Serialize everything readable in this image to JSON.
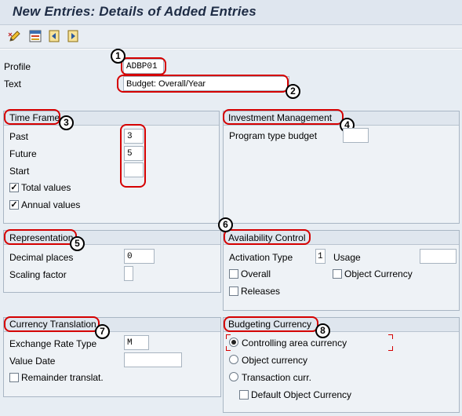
{
  "window": {
    "title": "New Entries: Details of Added Entries"
  },
  "toolbar": {
    "icons": [
      "edit-pencil-icon",
      "select-block-icon",
      "previous-entry-icon",
      "next-entry-icon"
    ]
  },
  "header": {
    "profile_label": "Profile",
    "profile_value": "ADBP01",
    "text_label": "Text",
    "text_value": "Budget: Overall/Year"
  },
  "time_frame": {
    "title": "Time Frame",
    "past_label": "Past",
    "past_value": "3",
    "future_label": "Future",
    "future_value": "5",
    "start_label": "Start",
    "start_value": "",
    "total_values_label": "Total values",
    "total_values_checked": true,
    "annual_values_label": "Annual values",
    "annual_values_checked": true
  },
  "investment_management": {
    "title": "Investment Management",
    "program_type_label": "Program type budget",
    "program_type_value": ""
  },
  "representation": {
    "title": "Representation",
    "decimal_places_label": "Decimal places",
    "decimal_places_value": "0",
    "scaling_factor_label": "Scaling factor",
    "scaling_factor_value": ""
  },
  "availability_control": {
    "title": "Availability Control",
    "activation_type_label": "Activation Type",
    "activation_type_value": "1",
    "usage_label": "Usage",
    "usage_value": "",
    "overall_label": "Overall",
    "object_currency_label": "Object Currency",
    "releases_label": "Releases"
  },
  "currency_translation": {
    "title": "Currency Translation",
    "exchange_rate_label": "Exchange Rate Type",
    "exchange_rate_value": "M",
    "value_date_label": "Value Date",
    "value_date_value": "",
    "remainder_label": "Remainder translat."
  },
  "budgeting_currency": {
    "title": "Budgeting Currency",
    "options": [
      "Controlling area currency",
      "Object currency",
      "Transaction curr."
    ],
    "selected": "Controlling area currency",
    "default_object_currency_label": "Default Object Currency"
  },
  "annotations": [
    "1",
    "2",
    "3",
    "4",
    "5",
    "6",
    "7",
    "8"
  ],
  "colors": {
    "annotation": "#d50000",
    "title_text": "#1e2c45",
    "background": "#e7edf3"
  }
}
